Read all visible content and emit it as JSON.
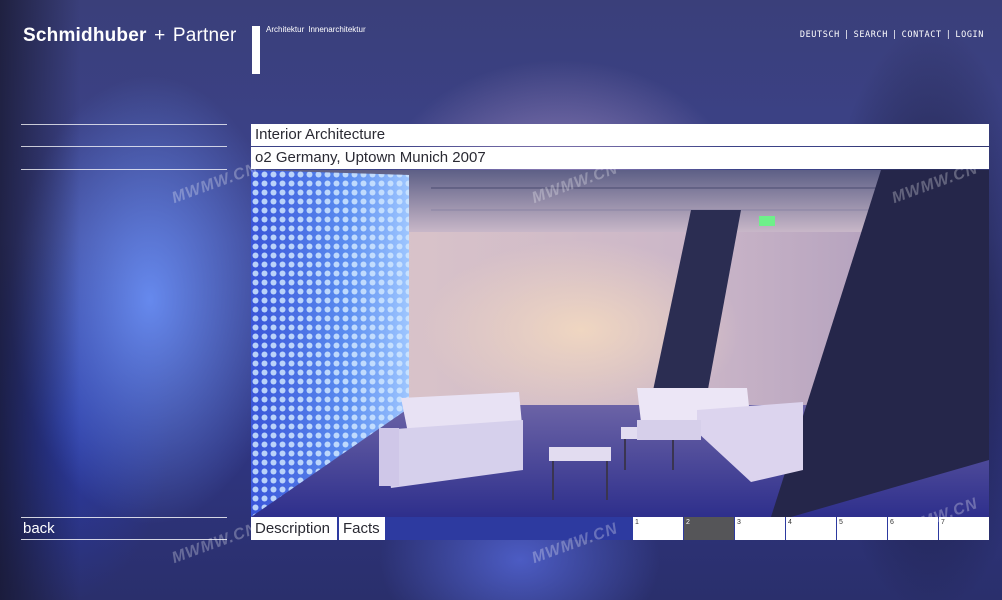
{
  "brand": {
    "name_bold": "Schmidhuber",
    "plus": "+",
    "name_light": "Partner",
    "tagline_1": "Architektur",
    "tagline_2": "Innenarchitektur"
  },
  "topnav": {
    "items": [
      "DEUTSCH",
      "SEARCH",
      "CONTACT",
      "LOGIN"
    ],
    "separator": "|"
  },
  "project": {
    "category": "Interior Architecture",
    "title": "o2 Germany, Uptown Munich 2007"
  },
  "sidebar": {
    "back_label": "back"
  },
  "tabs": {
    "description": "Description",
    "facts": "Facts"
  },
  "pagination": {
    "pages": [
      "1",
      "2",
      "3",
      "4",
      "5",
      "6",
      "7"
    ],
    "active_index": 1
  },
  "watermark": {
    "text": "MWMW.CN"
  },
  "colors": {
    "accent_blue": "#2d3aa0",
    "active_page": "#555558",
    "panel_white": "#ffffff"
  }
}
